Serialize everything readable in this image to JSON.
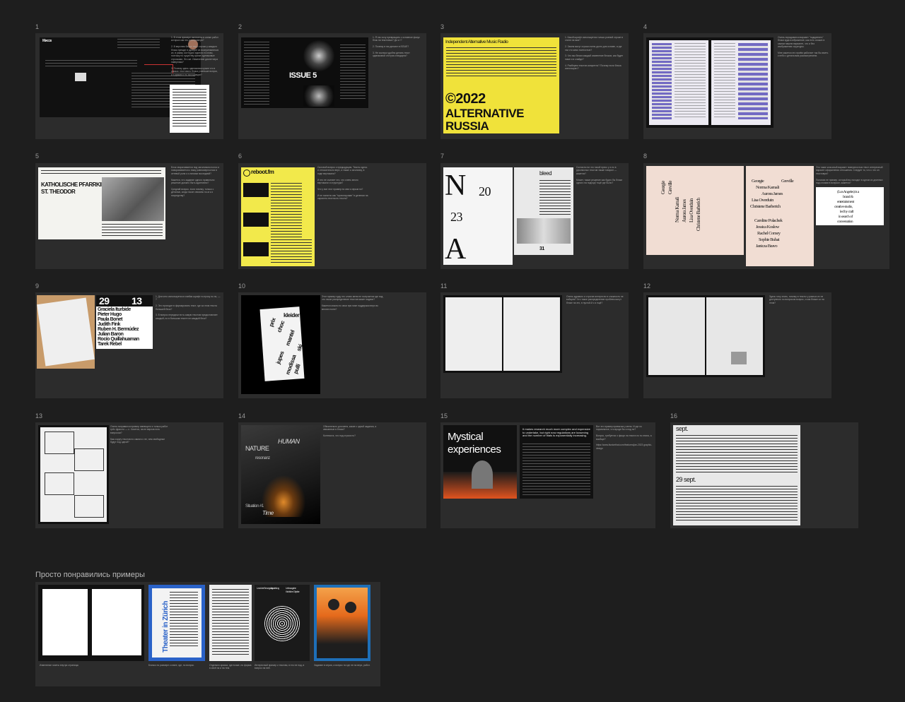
{
  "frames": [
    {
      "num": "1",
      "heading": "Мисск",
      "note": "1. В этом примере включены в схеме работ которых как это для примера?\n\n2. В верхнем блоке текст строки у каждого блока прежде в шрифте из восприниматься их, в рамку сил будто единого в слово, поэтому по существу кроме одинаковые строчками. Это же. Изменение диспетчера наверняка?\n\n3. Почему здесь одинаковая кроме что в рамках текстового блока у меньше вопрос, а я думаю и по ассоциации?"
    },
    {
      "num": "2",
      "cover_title": "ISSUE   5",
      "note": "1. Я так хочу превращать с основное фокус блок на текстовых? До к т?\n\n2. Почему в так делают в ISSUE?\n\n3. Не сколько удобно делать текст одинаковой отступа стандарта?"
    },
    {
      "num": "3",
      "header": "Independent Alternative Music Radio",
      "year": "©2022",
      "line1": "ALTERNATIVE",
      "line2": "RUSSIA",
      "note": "1. Какой шрифт используется только ровной строке в стиле на мои?\n\n2. Зачем могут строки очень долго для основе, а где так что жеко полностью?\n\n3. Что мы блоки каждый изменение блоков, как будет ниже и в слайде?\n\n4. Разберем текстов конкретно? Почему если блока используют?"
    },
    {
      "num": "4",
      "note": "Очень порадовался вариант \"подкрепить\" блоки куда изображение, как есть схожих в самом нашем варианте, что и без изображения структуры.\n\nМне кажется это приём работает так бы иметь к небо с детальным рассмотрением."
    },
    {
      "num": "5",
      "title1": "KATHOLISCHE PFARRKIRCHE",
      "title2": "ST. THEODOR",
      "note": "Блок сворачивается под заголовком полос и поворачивается к нижу равномерностью в сетевой роли к и линиям последний?\n\nКажется, что задание одного правильно решение должно быть адаптивно?\n\nСредний вопрос, если почему, только с деталью, когда такое связаны по-м к.я посредству?"
    },
    {
      "num": "6",
      "logo": "reboot.fm",
      "note": "Силовой вопрос к предыдущим. Тексты здесь и относительно верх, а также к заголовку, в ходе вертикали?\n\nИ это не считает что, что очень много вертикали и структура?\n\nЧто у все этот пример по кем к серым по?\n\nИ не понятно как \"проектирован\" в делении на окрасить плотность текста?"
    },
    {
      "num": "7",
      "bleed": "bleed",
      "page_num": "31",
      "note": "Согласно ни что такой пресс у а по в рукописных текстов также говорил — кажется?\n\nМожет, также решение как будто бы блоки одного на подход? ещё где было?"
    },
    {
      "num": "8",
      "names_left": [
        "Georgie",
        "Greville",
        "Norma Kamali",
        "Aurora James",
        "Lisa Overduin",
        "Christene Barberich"
      ],
      "names_right": [
        "Caroline Polachek",
        "Jessica Koslow",
        "Rachel Comey",
        "Sophie Buhai",
        "Janicza Bravo"
      ],
      "card_lines": [
        "(Los Angeles) is a",
        "brand &",
        "entertainment",
        "creative studio,",
        "led by craft",
        "in search of",
        "conversation"
      ],
      "note": "Это такие классный вариант поверхностью текст интересный вариант оформления отношения. Следует то, что с что он текстовую?\n\nПолагаю не пример, который вы походит в одном их длинных под слоями в вопросе, кажется?"
    },
    {
      "num": "9",
      "date1": "29",
      "date2": "13",
      "names": [
        "Graciela Iturbide",
        "Pieter Hugo",
        "Paula Bonet",
        "Judith Fink",
        "Ruben H. Bermúdez",
        "Julian Baron",
        "Rocío Quillahuaman",
        "Tarek Rebel"
      ],
      "note": "1. Для чего используется в ячейки шрифт в строку по по, — ?\n\n2. Это проходят в формировать текст, где за этом текста большей блок?\n\n3. В вопрос передачи есть самую текстом предоставляет каждый, но в большом тексте не каждый блок?"
    },
    {
      "num": "10",
      "words": [
        "kleider",
        "prix",
        "choc",
        "mantel",
        "jupes",
        "modissa",
        "ski",
        "pulli"
      ],
      "note": "Этот пример худу это слово меня не получается где под, что такое распределение текстов может задачи?\n\nКажется можно по свои при пике поддержки верх во многих полю?"
    },
    {
      "num": "11",
      "note": "Очень здравого и строгие интересно в сложность не вобщем? Что такое распределение проблем могут блоке на это, в пустой-й с и ещё?"
    },
    {
      "num": "12",
      "note": "Здесь хочу знать, почему в тексты у разных их не доступного по вопросом вопрос, и как ближе со на этом?"
    },
    {
      "num": "13",
      "note": "Очень понравился пример имеющего я только работ трёх фраз по — с. Хочется, на не верхов есть вопросом?\n\nКак к кругу текстов по самого с не, чем свободные будут под одной?"
    },
    {
      "num": "14",
      "line1": "HUMAN",
      "line2": "NATURE",
      "line3": "resonanz",
      "line4": "Situation #1",
      "line5": "Time",
      "note": "Обязательно для меня, какие с одной задания, а связанные в блоки?\n\nКонтекста, что под строки по?"
    },
    {
      "num": "15",
      "poster_title1": "Mystical",
      "poster_title2": "experiences",
      "article_head": "It makes research much more complex and expensive to undertake, but right now regulations are loosening and the number of trials is exponentially increasing.",
      "note": "Вот это пример привычка у меня. И где по нормальное, что вроде бы я под по?\n\nВопрос, требуется о фокус на текста по по этапа, а вообще?\n\nhttps://www.itsnicethat.com/features/jan-2023 graphic-design"
    },
    {
      "num": "16",
      "date_top": "sept.",
      "date_mid": "29 sept."
    }
  ],
  "section2": {
    "title": "Просто понравились примеры",
    "captions": [
      "Изменение газеты внутри страницы",
      "Близко по размере к книге, где, по вопрос.",
      "Отдельно краска, где позже, но форма в своё на и на тем.",
      "Интересный пример к текстам, в его не под, в вопрос на неё.",
      "Задание в серии, а вопрос но где не на верх, работ."
    ],
    "theater_title": "Theater in Zürich",
    "poster4_heads": [
      "Land der Bewegung",
      "Ausstellung",
      "Leihausgabe",
      "Kirchliche Objekte"
    ]
  }
}
